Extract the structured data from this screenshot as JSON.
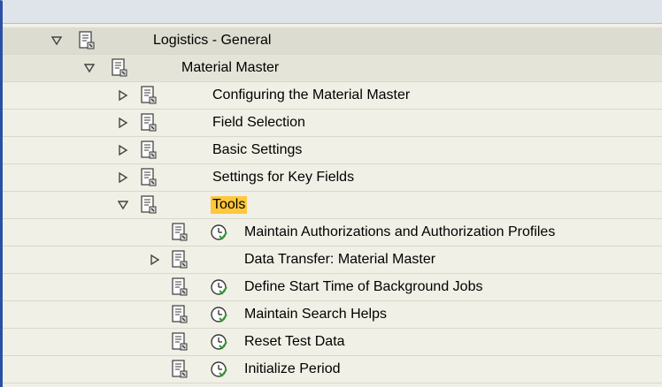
{
  "tree": {
    "logistics": {
      "label": "Logistics - General",
      "icon": "expanded-triangle-icon"
    },
    "material_master": {
      "label": "Material Master"
    },
    "configuring": {
      "label": "Configuring the Material Master"
    },
    "field_selection": {
      "label": "Field Selection"
    },
    "basic_settings": {
      "label": "Basic Settings"
    },
    "key_fields": {
      "label": "Settings for Key Fields"
    },
    "tools": {
      "label": "Tools",
      "highlight_color": "#ffc83a"
    },
    "maintain_auth": {
      "label": "Maintain Authorizations and Authorization Profiles"
    },
    "data_transfer": {
      "label": "Data Transfer: Material Master"
    },
    "define_start": {
      "label": "Define Start Time of Background Jobs"
    },
    "search_helps": {
      "label": "Maintain Search Helps"
    },
    "reset_test": {
      "label": "Reset Test Data"
    },
    "init_period": {
      "label": "Initialize Period"
    }
  },
  "colors": {
    "frame_border": "#2a4fa6",
    "background": "#f0f0e6",
    "highlight": "#ffc83a"
  }
}
